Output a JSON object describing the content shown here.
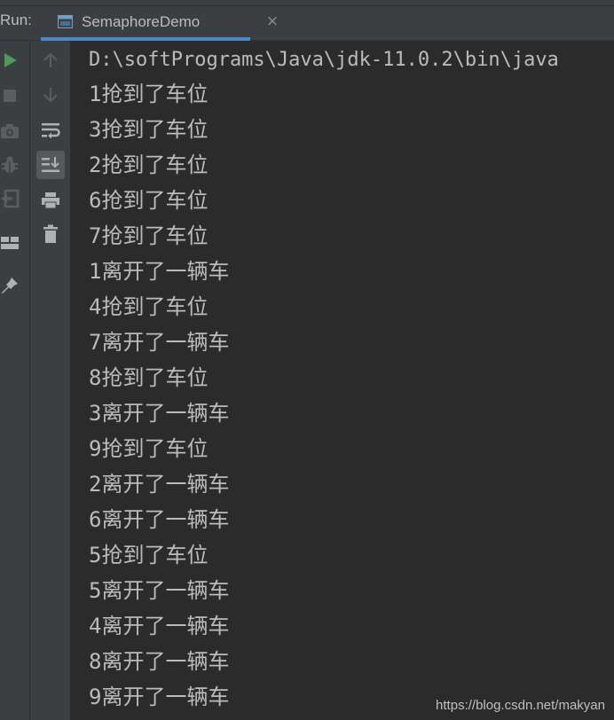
{
  "run_panel": {
    "label": "Run:",
    "tab": {
      "title": "SemaphoreDemo",
      "close_glyph": "×"
    }
  },
  "toolbars": {
    "outer": [
      {
        "name": "run-icon",
        "color": "#499c54"
      },
      {
        "name": "stop-icon",
        "color": "#5b5e60"
      },
      {
        "name": "camera-icon",
        "color": "#5b5e60"
      },
      {
        "name": "debug-bug-icon",
        "color": "#5b5e60"
      },
      {
        "name": "exit-icon",
        "color": "#5b5e60"
      },
      {
        "name": "layout-icon",
        "color": "#afb1b3"
      },
      {
        "name": "pin-icon",
        "color": "#afb1b3"
      }
    ],
    "inner": [
      {
        "name": "arrow-up-icon",
        "color": "#5b5e60"
      },
      {
        "name": "arrow-down-icon",
        "color": "#5b5e60"
      },
      {
        "name": "soft-wrap-icon",
        "color": "#afb1b3"
      },
      {
        "name": "scroll-to-end-icon",
        "color": "#afb1b3",
        "active": true
      },
      {
        "name": "print-icon",
        "color": "#afb1b3"
      },
      {
        "name": "trash-icon",
        "color": "#afb1b3"
      }
    ]
  },
  "console": {
    "command_line": "D:\\softPrograms\\Java\\jdk-11.0.2\\bin\\java",
    "lines": [
      "1抢到了车位",
      "3抢到了车位",
      "2抢到了车位",
      "6抢到了车位",
      "7抢到了车位",
      "1离开了一辆车",
      "4抢到了车位",
      "7离开了一辆车",
      "8抢到了车位",
      "3离开了一辆车",
      "9抢到了车位",
      "2离开了一辆车",
      "6离开了一辆车",
      "5抢到了车位",
      "5离开了一辆车",
      "4离开了一辆车",
      "8离开了一辆车",
      "9离开了一辆车"
    ]
  },
  "watermark": "https://blog.csdn.net/makyan",
  "colors": {
    "console_bg": "#2b2b2b",
    "toolbar_bg": "#3c3f41",
    "text": "#bbbbbb",
    "accent": "#4a88c7",
    "run_green": "#499c54"
  }
}
